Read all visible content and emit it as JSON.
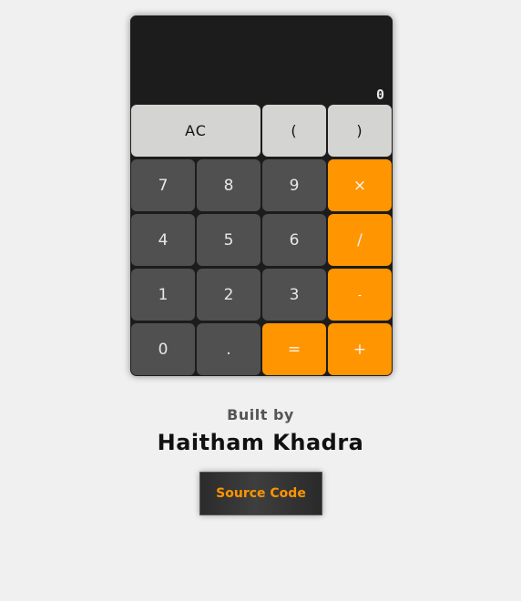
{
  "display": {
    "value": "0"
  },
  "keys": {
    "ac": "AC",
    "open_paren": "(",
    "close_paren": ")",
    "seven": "7",
    "eight": "8",
    "nine": "9",
    "multiply": "×",
    "four": "4",
    "five": "5",
    "six": "6",
    "divide": "/",
    "one": "1",
    "two": "2",
    "three": "3",
    "subtract": "-",
    "zero": "0",
    "decimal": ".",
    "equals": "=",
    "add": "+"
  },
  "credits": {
    "built_by": "Built by",
    "author": "Haitham Khadra",
    "source_button": "Source Code"
  },
  "colors": {
    "accent": "#ff9500",
    "key_dark": "#505050",
    "key_light": "#d4d4d2",
    "calculator_body": "#1c1c1c",
    "background": "#f0f0f0"
  }
}
